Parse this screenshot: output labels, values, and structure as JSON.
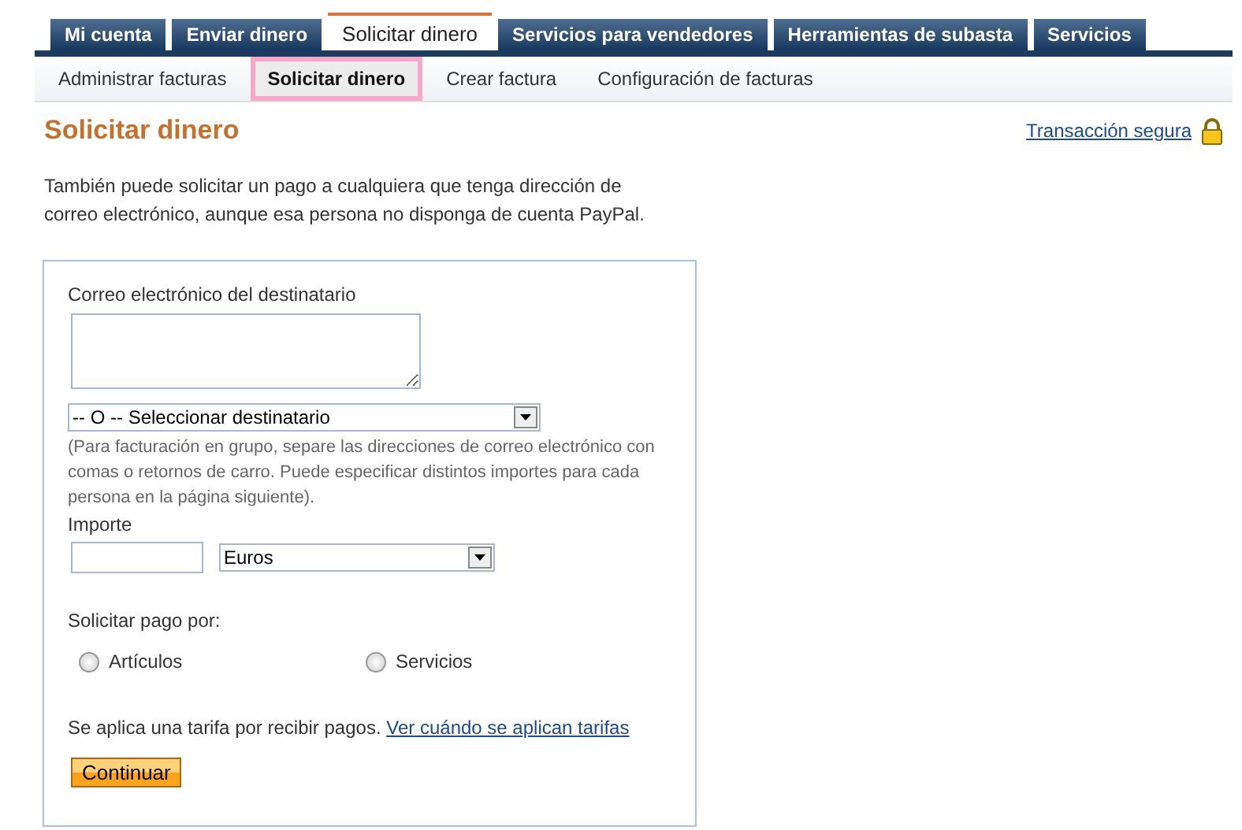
{
  "tabs": [
    {
      "label": "Mi cuenta",
      "selected": false
    },
    {
      "label": "Enviar dinero",
      "selected": false
    },
    {
      "label": "Solicitar dinero",
      "selected": true
    },
    {
      "label": "Servicios para vendedores",
      "selected": false
    },
    {
      "label": "Herramientas de subasta",
      "selected": false
    },
    {
      "label": "Servicios",
      "selected": false
    }
  ],
  "subtabs": [
    {
      "label": "Administrar facturas",
      "selected": false
    },
    {
      "label": "Solicitar dinero",
      "selected": true
    },
    {
      "label": "Crear factura",
      "selected": false
    },
    {
      "label": "Configuración de facturas",
      "selected": false
    }
  ],
  "heading": "Solicitar dinero",
  "secure_link": "Transacción segura",
  "intro": "También puede solicitar un pago a cualquiera que tenga dirección de correo electrónico, aunque esa persona no disponga de cuenta PayPal.",
  "form": {
    "email_label": "Correo electrónico del destinatario",
    "recipient_select": "-- O -- Seleccionar destinatario",
    "hint": "(Para facturación en grupo, separe las direcciones de correo electrónico con comas o retornos de carro. Puede especificar distintos importes para cada persona en la página siguiente).",
    "amount_label": "Importe",
    "currency": "Euros",
    "pay_for_label": "Solicitar pago por:",
    "options": [
      {
        "label": "Artículos",
        "selected": false
      },
      {
        "label": "Servicios",
        "selected": false
      }
    ],
    "fee_text": "Se aplica una tarifa por recibir pagos.",
    "fee_link": "Ver cuándo se aplican tarifas",
    "button": "Continuar"
  }
}
